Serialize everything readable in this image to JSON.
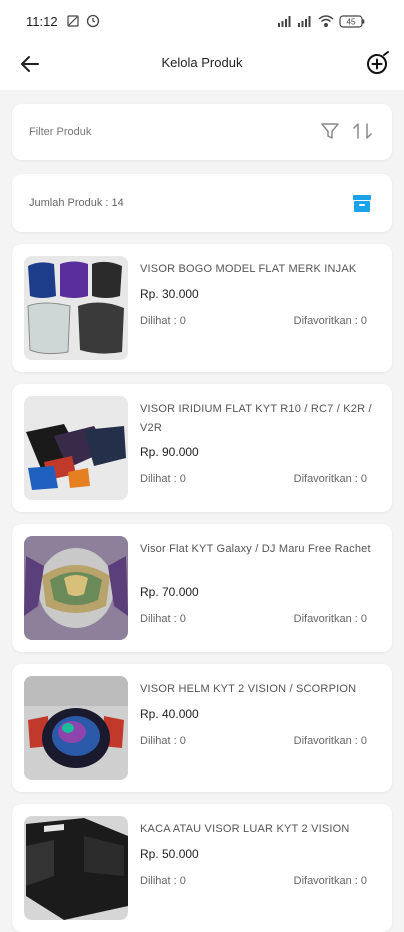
{
  "status": {
    "time": "11:12",
    "battery": "45"
  },
  "appbar": {
    "title": "Kelola Produk"
  },
  "filter": {
    "placeholder": "Filter Produk"
  },
  "summary": {
    "count_label": "Jumlah Produk : 14"
  },
  "colors": {
    "accent": "#1aa3e8"
  },
  "products": [
    {
      "name": "VISOR BOGO MODEL FLAT MERK INJAK",
      "price": "Rp. 30.000",
      "views": "Dilihat : 0",
      "favorites": "Difavoritkan : 0"
    },
    {
      "name": "VISOR IRIDIUM FLAT KYT R10 / RC7 / K2R / V2R",
      "price": "Rp. 90.000",
      "views": "Dilihat : 0",
      "favorites": "Difavoritkan : 0"
    },
    {
      "name": "Visor Flat KYT Galaxy / DJ Maru Free Rachet",
      "price": "Rp. 70.000",
      "views": "Dilihat : 0",
      "favorites": "Difavoritkan : 0"
    },
    {
      "name": "VISOR HELM KYT 2 VISION / SCORPION",
      "price": "Rp. 40.000",
      "views": "Dilihat : 0",
      "favorites": "Difavoritkan : 0"
    },
    {
      "name": "KACA ATAU VISOR LUAR KYT 2 VISION",
      "price": "Rp. 50.000",
      "views": "Dilihat : 0",
      "favorites": "Difavoritkan : 0"
    }
  ]
}
